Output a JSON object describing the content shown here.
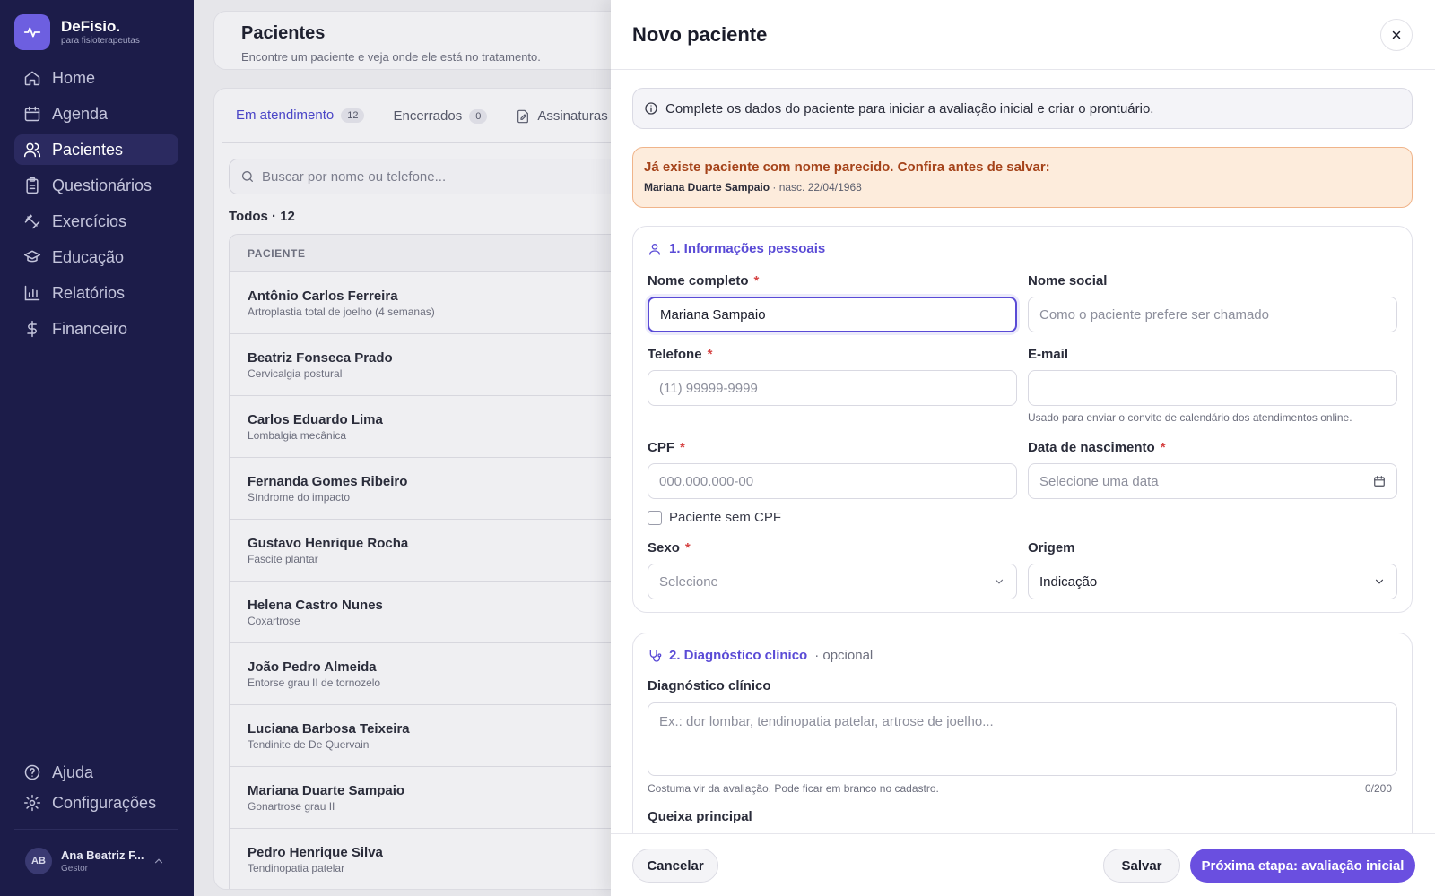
{
  "colors": {
    "sidebar_bg": "#1c1c49",
    "accent": "#5a4bd6",
    "primary_button": "#6a4fe0",
    "warning_bg": "#fdecdc",
    "warning_text": "#a5431a",
    "required": "#d64545"
  },
  "brand": {
    "name": "DeFisio.",
    "tagline": "para fisioterapeutas",
    "logo_icon": "pulse-icon"
  },
  "sidebar": {
    "items": [
      {
        "label": "Home",
        "icon": "home-icon",
        "active": false
      },
      {
        "label": "Agenda",
        "icon": "calendar-icon",
        "active": false
      },
      {
        "label": "Pacientes",
        "icon": "users-icon",
        "active": true
      },
      {
        "label": "Questionários",
        "icon": "clipboard-icon",
        "active": false
      },
      {
        "label": "Exercícios",
        "icon": "dumbbell-icon",
        "active": false
      },
      {
        "label": "Educação",
        "icon": "graduation-cap-icon",
        "active": false
      },
      {
        "label": "Relatórios",
        "icon": "bar-chart-icon",
        "active": false
      },
      {
        "label": "Financeiro",
        "icon": "dollar-icon",
        "active": false
      }
    ],
    "bottom_items": [
      {
        "label": "Ajuda",
        "icon": "help-circle-icon"
      },
      {
        "label": "Configurações",
        "icon": "gear-icon"
      }
    ],
    "user": {
      "initials": "AB",
      "name": "Ana Beatriz F...",
      "role": "Gestor"
    }
  },
  "page": {
    "title": "Pacientes",
    "subtitle": "Encontre um paciente e veja onde ele está no tratamento.",
    "tabs": [
      {
        "label": "Em atendimento",
        "count": "12",
        "active": true
      },
      {
        "label": "Encerrados",
        "count": "0",
        "active": false
      },
      {
        "label": "Assinaturas",
        "count": "",
        "active": false
      }
    ],
    "search_placeholder": "Buscar por nome ou telefone...",
    "count_label": "Todos · 12",
    "table_header": "PACIENTE",
    "patients": [
      {
        "name": "Antônio Carlos Ferreira",
        "diagnosis": "Artroplastia total de joelho (4 semanas)"
      },
      {
        "name": "Beatriz Fonseca Prado",
        "diagnosis": "Cervicalgia postural"
      },
      {
        "name": "Carlos Eduardo Lima",
        "diagnosis": "Lombalgia mecânica"
      },
      {
        "name": "Fernanda Gomes Ribeiro",
        "diagnosis": "Síndrome do impacto"
      },
      {
        "name": "Gustavo Henrique Rocha",
        "diagnosis": "Fascite plantar"
      },
      {
        "name": "Helena Castro Nunes",
        "diagnosis": "Coxartrose"
      },
      {
        "name": "João Pedro Almeida",
        "diagnosis": "Entorse grau II de tornozelo"
      },
      {
        "name": "Luciana Barbosa Teixeira",
        "diagnosis": "Tendinite de De Quervain"
      },
      {
        "name": "Mariana Duarte Sampaio",
        "diagnosis": "Gonartrose grau II"
      },
      {
        "name": "Pedro Henrique Silva",
        "diagnosis": "Tendinopatia patelar"
      }
    ]
  },
  "modal": {
    "title": "Novo paciente",
    "info": "Complete os dados do paciente para iniciar a avaliação inicial e criar o prontuário.",
    "warning": {
      "title": "Já existe paciente com nome parecido. Confira antes de salvar:",
      "match_name": "Mariana Duarte Sampaio",
      "match_detail": " · nasc. 22/04/1968"
    },
    "section1": {
      "title": "1. Informações pessoais",
      "full_name": {
        "label": "Nome completo",
        "value": "Mariana Sampaio"
      },
      "social_name": {
        "label": "Nome social",
        "placeholder": "Como o paciente prefere ser chamado"
      },
      "phone": {
        "label": "Telefone",
        "placeholder": "(11) 99999-9999"
      },
      "email": {
        "label": "E-mail",
        "value": "",
        "hint": "Usado para enviar o convite de calendário dos atendimentos online."
      },
      "cpf": {
        "label": "CPF",
        "placeholder": "000.000.000-00"
      },
      "birth_date": {
        "label": "Data de nascimento",
        "placeholder": "Selecione uma data"
      },
      "no_cpf_label": "Paciente sem CPF",
      "sex": {
        "label": "Sexo",
        "placeholder": "Selecione"
      },
      "origin": {
        "label": "Origem",
        "value": "Indicação"
      }
    },
    "section2": {
      "title": "2. Diagnóstico clínico",
      "optional": "· opcional",
      "diagnosis": {
        "label": "Diagnóstico clínico",
        "placeholder": "Ex.: dor lombar, tendinopatia patelar, artrose de joelho...",
        "hint": "Costuma vir da avaliação. Pode ficar em branco no cadastro.",
        "counter": "0/200"
      },
      "complaint_label": "Queixa principal"
    },
    "footer": {
      "cancel": "Cancelar",
      "save": "Salvar",
      "next": "Próxima etapa: avaliação inicial"
    },
    "required_mark": "*"
  }
}
